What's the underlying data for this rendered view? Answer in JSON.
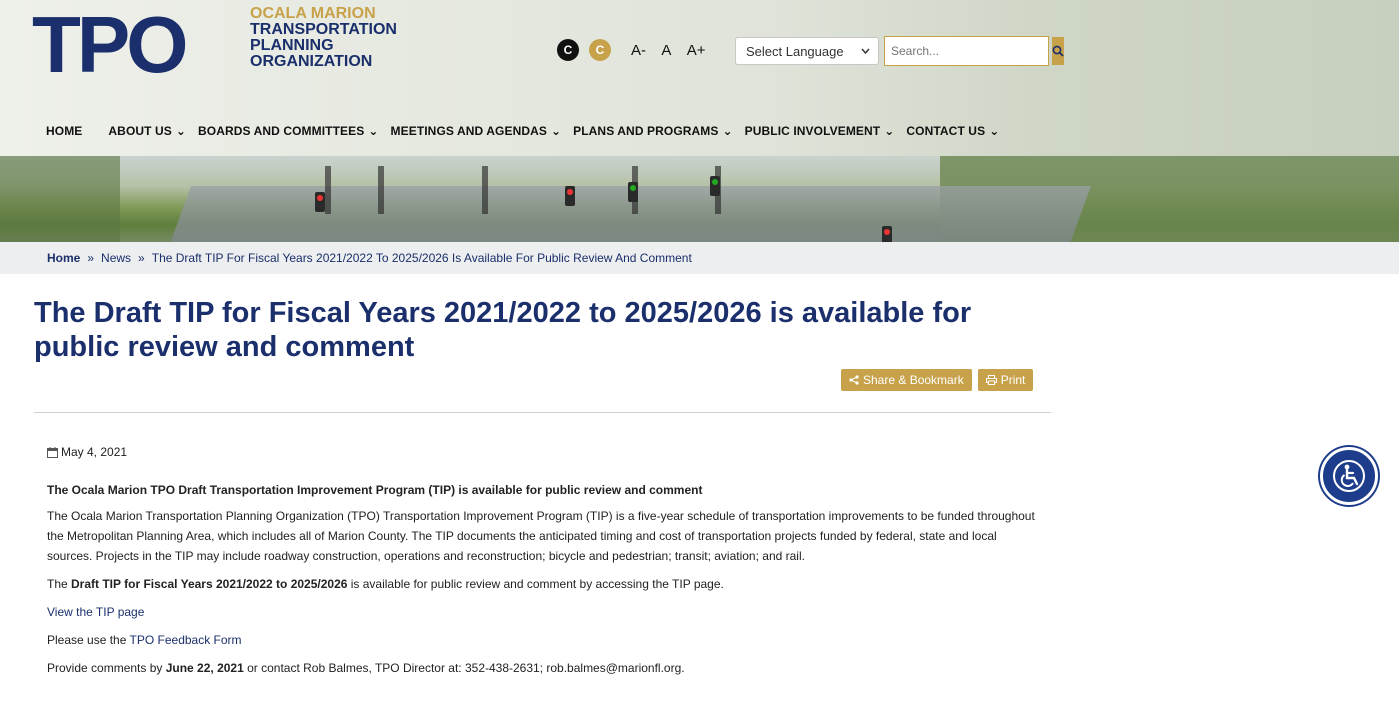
{
  "branding": {
    "logo_mark": "TPO",
    "logo_line1": "OCALA MARION",
    "logo_line2": "TRANSPORTATION",
    "logo_line3": "PLANNING",
    "logo_line4": "ORGANIZATION"
  },
  "tools": {
    "contrast_dark": "C",
    "contrast_gold": "C",
    "font_smaller": "A-",
    "font_normal": "A",
    "font_larger": "A+",
    "language_select": "Select Language",
    "search_placeholder": "Search..."
  },
  "nav": {
    "items": [
      {
        "label": "HOME",
        "has_dropdown": false
      },
      {
        "label": "ABOUT US",
        "has_dropdown": true
      },
      {
        "label": "BOARDS AND COMMITTEES",
        "has_dropdown": true
      },
      {
        "label": "MEETINGS AND AGENDAS",
        "has_dropdown": true
      },
      {
        "label": "PLANS AND PROGRAMS",
        "has_dropdown": true
      },
      {
        "label": "PUBLIC INVOLVEMENT",
        "has_dropdown": true
      },
      {
        "label": "CONTACT US",
        "has_dropdown": true
      }
    ]
  },
  "breadcrumb": {
    "home": "Home",
    "news": "News",
    "current": "The Draft TIP For Fiscal Years 2021/2022 To 2025/2026 Is Available For Public Review And Comment",
    "separator": "»"
  },
  "article": {
    "title": "The Draft TIP for Fiscal Years 2021/2022 to 2025/2026 is available for public review and comment",
    "share_label": "Share & Bookmark",
    "print_label": "Print",
    "date": "May 4, 2021",
    "heading": "The Ocala Marion TPO Draft Transportation Improvement Program (TIP) is available for public review and comment",
    "paragraph1": "The Ocala Marion Transportation Planning Organization (TPO) Transportation Improvement Program (TIP) is a five-year schedule of transportation improvements to be funded throughout the Metropolitan Planning Area, which includes all of Marion County. The TIP documents the anticipated timing and cost of transportation projects funded by federal, state and local sources. Projects in the TIP may include roadway construction, operations and reconstruction; bicycle and pedestrian; transit; aviation; and rail.",
    "p2_prefix": "The ",
    "p2_bold": "Draft TIP for Fiscal Years 2021/2022 to 2025/2026",
    "p2_suffix": " is available for public review and comment by accessing the TIP page.",
    "link_tip": "View the TIP page",
    "p3_prefix": "Please use the ",
    "link_feedback": "TPO Feedback Form",
    "p4_prefix": "Provide comments by ",
    "p4_bold": "June 22, 2021",
    "p4_suffix": " or contact Rob Balmes, TPO Director at: 352-438-2631; rob.balmes@marionfl.org."
  },
  "colors": {
    "navy": "#1a2f6b",
    "gold": "#c7a24a"
  }
}
